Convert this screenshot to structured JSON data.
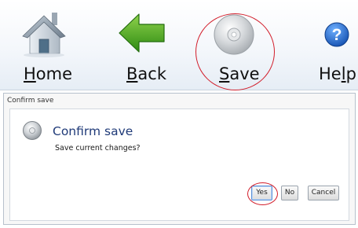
{
  "toolbar": {
    "home_label": "Home",
    "back_label": "Back",
    "save_label": "Save",
    "help_label": "Help",
    "icons": {
      "home": "home-icon",
      "back": "back-arrow-icon",
      "save": "disc-save-icon",
      "help": "help-icon"
    }
  },
  "dialog": {
    "title": "Confirm save",
    "heading": "Confirm save",
    "message": "Save current changes?",
    "icon": "disc-icon",
    "buttons": {
      "yes": "Yes",
      "no": "No",
      "cancel": "Cancel"
    }
  },
  "colors": {
    "highlight": "#d21d2a",
    "heading": "#1f3a78",
    "back_arrow": "#3f9a1c",
    "help": "#2167c9"
  }
}
